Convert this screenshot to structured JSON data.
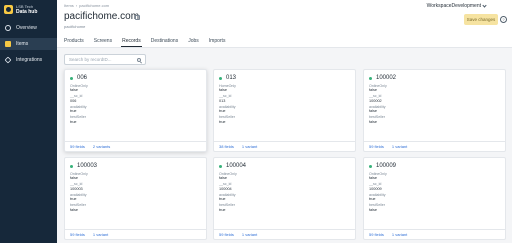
{
  "sidebar": {
    "org": "LSB Tech",
    "app_name": "Data hub",
    "items": [
      {
        "label": "Overview"
      },
      {
        "label": "Items"
      },
      {
        "label": "Integrations"
      }
    ]
  },
  "header": {
    "breadcrumb": [
      "Items",
      "pacifichome.com"
    ],
    "title": "pacifichome.com",
    "subtitle": "pacifichome",
    "workspace": "WorkspaceDevelopment",
    "save_label": "Save changes",
    "help_label": "?",
    "tabs": [
      "Products",
      "Screens",
      "Records",
      "Destinations",
      "Jobs",
      "Imports"
    ],
    "active_tab": "Records"
  },
  "search": {
    "placeholder": "Search by recordID..."
  },
  "records": [
    {
      "id": "006",
      "fields": [
        [
          "OnlineOnly",
          "false"
        ],
        [
          "__sc_id",
          "006"
        ],
        [
          "availability",
          "true"
        ],
        [
          "bestSeller",
          "true"
        ]
      ],
      "fields_link": "59 fields",
      "variants_link": "2 variants"
    },
    {
      "id": "013",
      "fields": [
        [
          "HomeOnly",
          "false"
        ],
        [
          "__sc_id",
          "013"
        ],
        [
          "availability",
          "true"
        ],
        [
          "bestSeller",
          "true"
        ]
      ],
      "fields_link": "38 fields",
      "variants_link": "1 variant"
    },
    {
      "id": "100002",
      "fields": [
        [
          "OnlineOnly",
          "false"
        ],
        [
          "__sc_id",
          "100002"
        ],
        [
          "availability",
          "false"
        ],
        [
          "bestSeller",
          "false"
        ]
      ],
      "fields_link": "59 fields",
      "variants_link": "1 variant"
    },
    {
      "id": "100003",
      "fields": [
        [
          "OnlineOnly",
          "false"
        ],
        [
          "__sc_id",
          "100003"
        ],
        [
          "availability",
          "true"
        ],
        [
          "bestSeller",
          "false"
        ]
      ],
      "fields_link": "59 fields",
      "variants_link": "1 variant"
    },
    {
      "id": "100004",
      "fields": [
        [
          "OnlineOnly",
          "false"
        ],
        [
          "__sc_id",
          "100004"
        ],
        [
          "availability",
          "true"
        ],
        [
          "bestSeller",
          "true"
        ]
      ],
      "fields_link": "59 fields",
      "variants_link": "1 variant"
    },
    {
      "id": "100009",
      "fields": [
        [
          "OnlineOnly",
          "false"
        ],
        [
          "__sc_id",
          "100009"
        ],
        [
          "availability",
          "true"
        ],
        [
          "bestSeller",
          "false"
        ]
      ],
      "fields_link": "59 fields",
      "variants_link": "1 variant"
    }
  ],
  "colors": {
    "sidebar_bg": "#16283a",
    "accent": "#f7c944",
    "status_dot": "#38b27a",
    "link": "#2f6fd6"
  }
}
